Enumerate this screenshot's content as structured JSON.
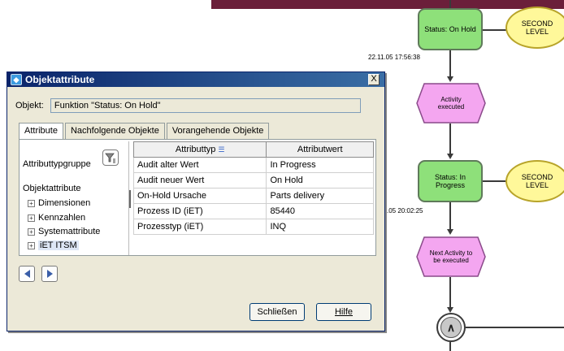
{
  "diagram": {
    "status_on_hold": "Status: On Hold",
    "second_level_1": "SECOND\nLEVEL",
    "timestamp_1": "22.11.05 17:56:38",
    "activity_executed": "Activity\nexecuted",
    "status_in_progress": "Status: In\nProgress",
    "second_level_2": "SECOND\nLEVEL",
    "timestamp_2": ".05 20:02:25",
    "next_activity": "Next Activity to\nbe executed",
    "colors": {
      "function": "#8ee07a",
      "event": "#f4a6f0",
      "process_interface": "#fff89a",
      "topbar": "#6b1f3a"
    }
  },
  "dialog": {
    "title": "Objektattribute",
    "close_label": "X",
    "object_label": "Objekt:",
    "object_value": "Funktion \"Status: On Hold\"",
    "tabs": [
      {
        "label": "Attribute"
      },
      {
        "label": "Nachfolgende Objekte"
      },
      {
        "label": "Vorangehende Objekte"
      }
    ],
    "tree": {
      "header": "Attributtypgruppe",
      "root": "Objektattribute",
      "items": [
        {
          "label": "Dimensionen"
        },
        {
          "label": "Kennzahlen"
        },
        {
          "label": "Systemattribute"
        },
        {
          "label": "iET ITSM"
        }
      ]
    },
    "table": {
      "columns": [
        "Attributtyp",
        "Attributwert"
      ],
      "rows": [
        [
          "Audit alter Wert",
          "In Progress"
        ],
        [
          "Audit neuer Wert",
          "On Hold"
        ],
        [
          "On-Hold Ursache",
          "Parts delivery"
        ],
        [
          "Prozess ID (iET)",
          "85440"
        ],
        [
          "Prozesstyp (iET)",
          "INQ"
        ]
      ]
    },
    "buttons": {
      "close": "Schließen",
      "help": "Hilfe"
    }
  }
}
